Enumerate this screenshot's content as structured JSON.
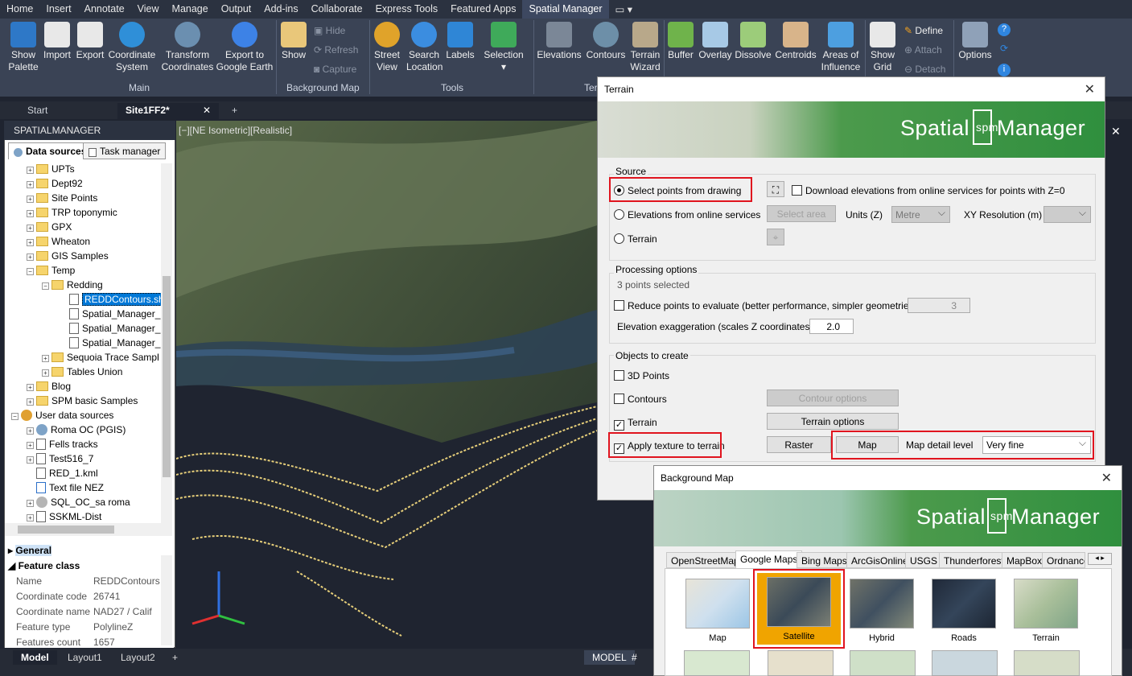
{
  "menubar": [
    "Home",
    "Insert",
    "Annotate",
    "View",
    "Manage",
    "Output",
    "Add-ins",
    "Collaborate",
    "Express Tools",
    "Featured Apps",
    "Spatial Manager"
  ],
  "menubar_active": "Spatial Manager",
  "ribbon": {
    "main": {
      "show_palette": "Show\nPalette",
      "import": "Import",
      "export": "Export",
      "coordinate_system": "Coordinate\nSystem",
      "transform": "Transform\nCoordinates",
      "export_google": "Export to\nGoogle Earth",
      "group": "Main"
    },
    "background_map": {
      "show": "Show",
      "hide": "Hide",
      "refresh": "Refresh",
      "capture": "Capture",
      "group": "Background Map"
    },
    "tools": {
      "street_view": "Street\nView",
      "search_location": "Search\nLocation",
      "labels": "Labels",
      "selection": "Selection",
      "group": "Tools"
    },
    "terrain": {
      "elevations": "Elevations",
      "contours": "Contours",
      "terrain_wizard": "Terrain\nWizard",
      "group": "Ter"
    },
    "geo": {
      "buffer": "Buffer",
      "overlay": "Overlay",
      "dissolve": "Dissolve",
      "centroids": "Centroids",
      "areas": "Areas of\nInfluence",
      "show_grid": "Show\nGrid",
      "define": "Define",
      "attach": "Attach",
      "detach": "Detach",
      "options": "Options"
    }
  },
  "doc_tabs": {
    "start": "Start",
    "active": "Site1FF2*",
    "add": "+"
  },
  "palette": {
    "title": "SPATIALMANAGER",
    "tab_data": "Data sources",
    "tab_task": "Task manager",
    "tree": [
      "UPTs",
      "Dept92",
      "Site Points",
      "TRP toponymic",
      "GPX",
      "Wheaton",
      "GIS Samples",
      "Temp",
      "Redding",
      "REDDContours.sh",
      "Spatial_Manager_",
      "Spatial_Manager_",
      "Spatial_Manager_",
      "Sequoia Trace Sampl",
      "Tables Union",
      "Blog",
      "SPM basic Samples",
      "User data sources",
      "Roma OC (PGIS)",
      "Fells tracks",
      "Test516_7",
      "RED_1.kml",
      "Text file NEZ",
      "SQL_OC_sa roma",
      "SSKML-Dist"
    ],
    "props": {
      "general": "General",
      "feature_class": "Feature class",
      "rows": [
        [
          "Name",
          "REDDContours"
        ],
        [
          "Coordinate code",
          "26741"
        ],
        [
          "Coordinate name",
          "NAD27 / Calif"
        ],
        [
          "Feature type",
          "PolylineZ"
        ],
        [
          "Features count",
          "1657"
        ]
      ]
    }
  },
  "viewport_label": "[−][NE Isometric][Realistic]",
  "bottom": {
    "model": "Model",
    "layout1": "Layout1",
    "layout2": "Layout2",
    "add": "+",
    "model_btn": "MODEL"
  },
  "terrain_dialog": {
    "title": "Terrain",
    "logo_left": "Spatial",
    "logo_mid": "spm",
    "logo_right": "Manager",
    "source_label": "Source",
    "opt_select": "Select points from drawing",
    "opt_online": "Elevations from online services",
    "opt_terrain": "Terrain",
    "download_chk": "Download elevations from online services for points with Z=0",
    "select_area": "Select area",
    "units_label": "Units (Z)",
    "units_value": "Metre",
    "xy_label": "XY Resolution (m)",
    "processing_label": "Processing options",
    "points_selected": "3 points selected",
    "reduce_chk": "Reduce points to evaluate (better performance, simpler geometries)",
    "reduce_value": "3",
    "exag_label": "Elevation exaggeration (scales Z coordinates)",
    "exag_value": "2.0",
    "objects_label": "Objects to create",
    "chk_3d": "3D Points",
    "chk_contours": "Contours",
    "contour_options": "Contour options",
    "chk_terrain": "Terrain",
    "terrain_options": "Terrain options",
    "chk_texture": "Apply texture to terrain",
    "raster": "Raster",
    "map": "Map",
    "detail_label": "Map detail level",
    "detail_value": "Very fine"
  },
  "bg_dialog": {
    "title": "Background Map",
    "logo_left": "Spatial",
    "logo_mid": "spm",
    "logo_right": "Manager",
    "tabs": [
      "OpenStreetMap",
      "Google Maps",
      "Bing Maps",
      "ArcGisOnline",
      "USGS",
      "Thunderforest",
      "MapBox",
      "Ordnance"
    ],
    "active_tab": "Google Maps",
    "thumbs": [
      "Map",
      "Satellite",
      "Hybrid",
      "Roads",
      "Terrain"
    ],
    "selected": "Satellite"
  }
}
